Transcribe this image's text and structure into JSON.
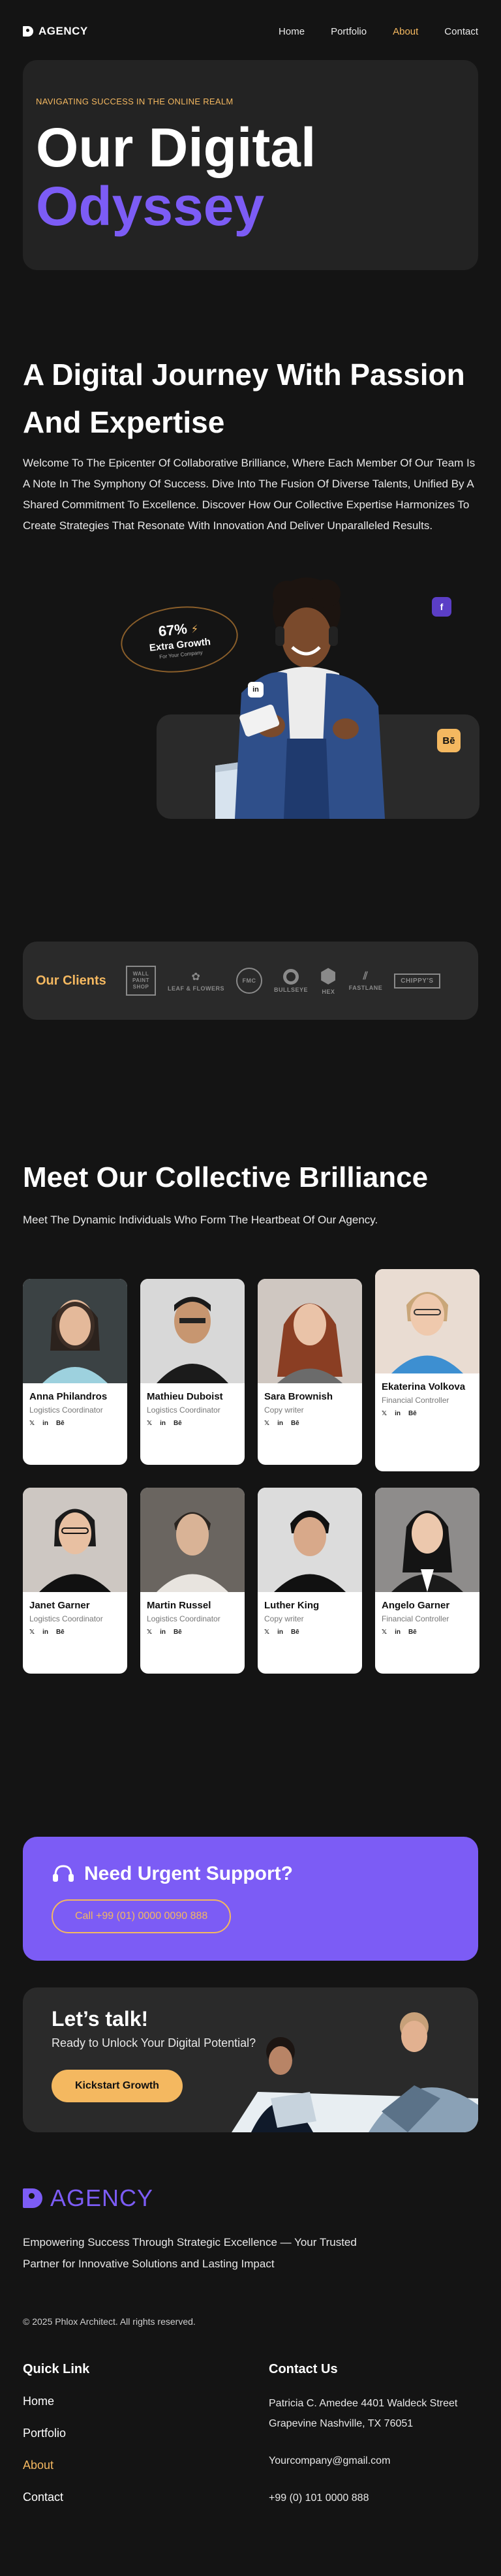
{
  "nav": {
    "brand": "AGENCY",
    "links": [
      "Home",
      "Portfolio",
      "About",
      "Contact"
    ],
    "active": "About"
  },
  "hero": {
    "kicker": "NAVIGATING SUCCESS IN THE ONLINE REALM",
    "title_line1": "Our Digital",
    "title_line2": "Odyssey"
  },
  "journey": {
    "title": "A Digital Journey With Passion And Expertise",
    "text": "Welcome To The Epicenter Of Collaborative Brilliance, Where Each Member Of Our Team Is A Note In The Symphony Of Success. Dive Into The Fusion Of Diverse Talents, Unified By A Shared Commitment To Excellence. Discover How Our Collective Expertise Harmonizes To Create Strategies That Resonate With Innovation And Deliver Unparalleled Results."
  },
  "growth": {
    "percent": "67%",
    "label": "Extra Growth",
    "sub": "For Your Company"
  },
  "social_badges": {
    "facebook": "f",
    "linkedin": "in",
    "behance": "Bē"
  },
  "clients": {
    "title": "Our Clients",
    "logos": [
      "WALL PAINT SHOP",
      "LEAF & FLOWERS",
      "FMC",
      "BULLSEYE",
      "HEX",
      "FASTLANE",
      "CHIPPY'S"
    ]
  },
  "team": {
    "title": "Meet Our Collective Brilliance",
    "subtitle": "Meet The Dynamic Individuals Who Form The Heartbeat Of Our Agency.",
    "members": [
      {
        "name": "Anna Philandros",
        "role": "Logistics Coordinator"
      },
      {
        "name": "Mathieu Duboist",
        "role": "Logistics Coordinator"
      },
      {
        "name": "Sara Brownish",
        "role": "Copy writer"
      },
      {
        "name": "Ekaterina Volkova",
        "role": "Financial Controller"
      },
      {
        "name": "Janet Garner",
        "role": "Logistics Coordinator"
      },
      {
        "name": "Martin Russel",
        "role": "Logistics Coordinator"
      },
      {
        "name": "Luther King",
        "role": "Copy writer"
      },
      {
        "name": "Angelo Garner",
        "role": "Financial Controller"
      }
    ],
    "social": [
      "𝕏",
      "in",
      "Bē"
    ]
  },
  "support": {
    "title": "Need Urgent Support?",
    "call": "Call +99 (01) 0000 0090 888"
  },
  "talk": {
    "title": "Let’s talk!",
    "subtitle": "Ready to Unlock Your Digital Potential?",
    "button": "Kickstart Growth"
  },
  "footer": {
    "brand": "AGENCY",
    "tagline": "Empowering Success Through Strategic Excellence — Your Trusted Partner for Innovative Solutions and Lasting Impact",
    "copyright": "© 2025 Phlox Architect. All rights reserved.",
    "quick_title": "Quick Link",
    "quick_links": [
      "Home",
      "Portfolio",
      "About",
      "Contact"
    ],
    "quick_active": "About",
    "contact_title": "Contact Us",
    "address_line1": "Patricia C. Amedee 4401 Waldeck Street",
    "address_line2": "Grapevine Nashville, TX 76051",
    "email": "Yourcompany@gmail.com",
    "phone": "+99 (0) 101 0000 888"
  },
  "colors": {
    "bg": "#141414",
    "card": "#232323",
    "purple": "#7c5cf5",
    "gold": "#f4b860"
  }
}
